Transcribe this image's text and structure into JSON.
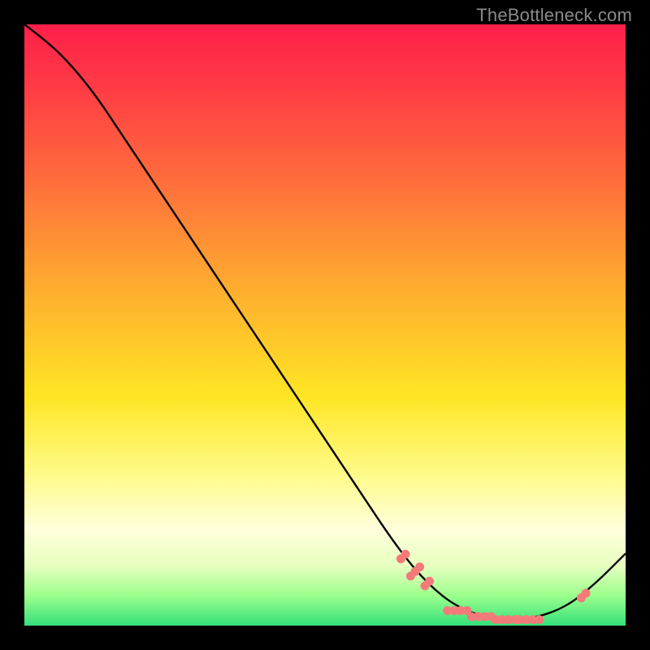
{
  "attribution": "TheBottleneck.com",
  "colors": {
    "dot_fill": "#f47a7a",
    "curve_stroke": "#000000",
    "frame_bg": "#000000"
  },
  "chart_data": {
    "type": "line",
    "title": "",
    "xlabel": "",
    "ylabel": "",
    "xlim": [
      0,
      100
    ],
    "ylim": [
      0,
      100
    ],
    "grid": false,
    "legend": false,
    "curve_points": [
      {
        "x": 0,
        "y": 100
      },
      {
        "x": 4,
        "y": 97
      },
      {
        "x": 8,
        "y": 93
      },
      {
        "x": 12,
        "y": 88
      },
      {
        "x": 16,
        "y": 82
      },
      {
        "x": 25,
        "y": 68.5
      },
      {
        "x": 35,
        "y": 53.5
      },
      {
        "x": 45,
        "y": 38.5
      },
      {
        "x": 55,
        "y": 23.5
      },
      {
        "x": 62,
        "y": 13
      },
      {
        "x": 67,
        "y": 7
      },
      {
        "x": 72,
        "y": 3
      },
      {
        "x": 78,
        "y": 1
      },
      {
        "x": 84,
        "y": 1
      },
      {
        "x": 90,
        "y": 3
      },
      {
        "x": 95,
        "y": 7
      },
      {
        "x": 100,
        "y": 12
      }
    ],
    "dot_clusters": [
      {
        "x": 63,
        "y": 11.5,
        "count": 2,
        "orientation": "diag"
      },
      {
        "x": 65,
        "y": 9,
        "count": 3,
        "orientation": "diag"
      },
      {
        "x": 67,
        "y": 7,
        "count": 2,
        "orientation": "diag"
      },
      {
        "x": 72,
        "y": 2.5,
        "count": 4,
        "orientation": "horiz"
      },
      {
        "x": 76,
        "y": 1.5,
        "count": 4,
        "orientation": "horiz"
      },
      {
        "x": 80,
        "y": 1,
        "count": 4,
        "orientation": "horiz"
      },
      {
        "x": 84,
        "y": 1,
        "count": 4,
        "orientation": "horiz"
      },
      {
        "x": 93,
        "y": 5,
        "count": 2,
        "orientation": "diag"
      }
    ]
  }
}
